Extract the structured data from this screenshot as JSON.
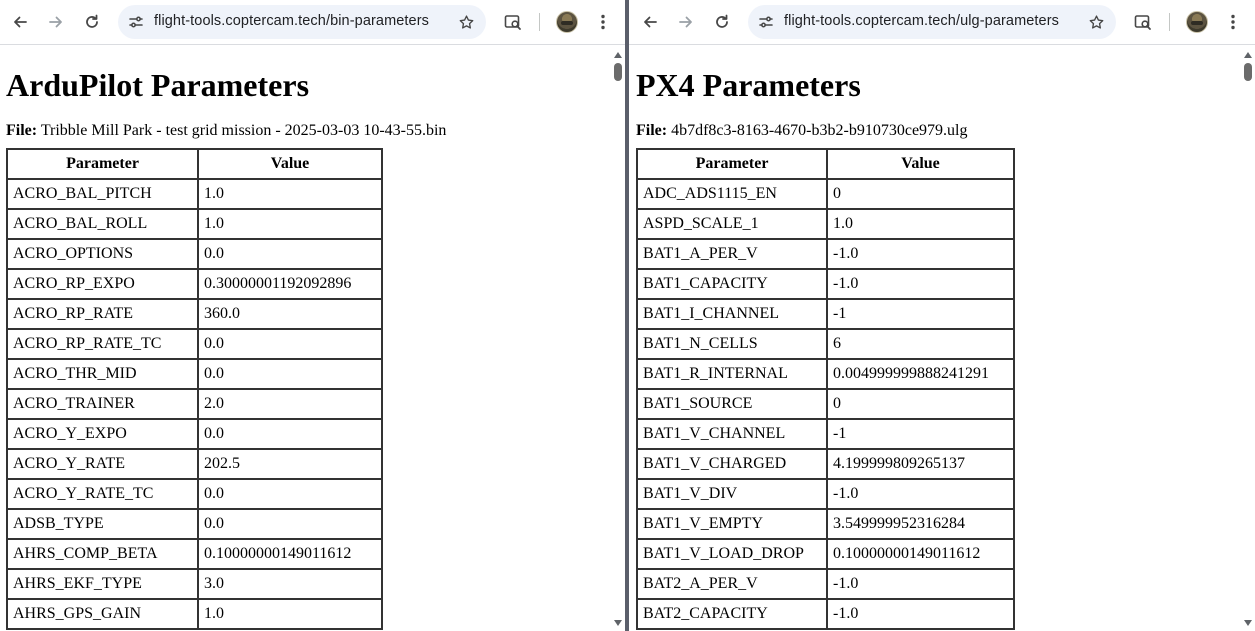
{
  "icons": {
    "back": "arrow-left-icon",
    "forward": "arrow-right-icon",
    "reload": "reload-icon",
    "site_info": "tune-icon",
    "bookmark": "star-icon",
    "page_search": "search-page-icon",
    "profile": "avatar",
    "menu": "kebab-menu-icon"
  },
  "colors": {
    "divider": "#5b5f6b",
    "omnibox_bg": "#eff3fa",
    "table_border": "#333333"
  },
  "left": {
    "url": "flight-tools.coptercam.tech/bin-parameters",
    "title": "ArduPilot Parameters",
    "file_label": "File:",
    "file_name": "Tribble Mill Park - test grid mission - 2025-03-03 10-43-55.bin",
    "headers": {
      "param": "Parameter",
      "value": "Value"
    },
    "rows": [
      {
        "param": "ACRO_BAL_PITCH",
        "value": "1.0"
      },
      {
        "param": "ACRO_BAL_ROLL",
        "value": "1.0"
      },
      {
        "param": "ACRO_OPTIONS",
        "value": "0.0"
      },
      {
        "param": "ACRO_RP_EXPO",
        "value": "0.30000001192092896"
      },
      {
        "param": "ACRO_RP_RATE",
        "value": "360.0"
      },
      {
        "param": "ACRO_RP_RATE_TC",
        "value": "0.0"
      },
      {
        "param": "ACRO_THR_MID",
        "value": "0.0"
      },
      {
        "param": "ACRO_TRAINER",
        "value": "2.0"
      },
      {
        "param": "ACRO_Y_EXPO",
        "value": "0.0"
      },
      {
        "param": "ACRO_Y_RATE",
        "value": "202.5"
      },
      {
        "param": "ACRO_Y_RATE_TC",
        "value": "0.0"
      },
      {
        "param": "ADSB_TYPE",
        "value": "0.0"
      },
      {
        "param": "AHRS_COMP_BETA",
        "value": "0.10000000149011612"
      },
      {
        "param": "AHRS_EKF_TYPE",
        "value": "3.0"
      },
      {
        "param": "AHRS_GPS_GAIN",
        "value": "1.0"
      }
    ]
  },
  "right": {
    "url": "flight-tools.coptercam.tech/ulg-parameters",
    "title": "PX4 Parameters",
    "file_label": "File:",
    "file_name": "4b7df8c3-8163-4670-b3b2-b910730ce979.ulg",
    "headers": {
      "param": "Parameter",
      "value": "Value"
    },
    "rows": [
      {
        "param": "ADC_ADS1115_EN",
        "value": "0"
      },
      {
        "param": "ASPD_SCALE_1",
        "value": "1.0"
      },
      {
        "param": "BAT1_A_PER_V",
        "value": "-1.0"
      },
      {
        "param": "BAT1_CAPACITY",
        "value": "-1.0"
      },
      {
        "param": "BAT1_I_CHANNEL",
        "value": "-1"
      },
      {
        "param": "BAT1_N_CELLS",
        "value": "6"
      },
      {
        "param": "BAT1_R_INTERNAL",
        "value": "0.004999999888241291"
      },
      {
        "param": "BAT1_SOURCE",
        "value": "0"
      },
      {
        "param": "BAT1_V_CHANNEL",
        "value": "-1"
      },
      {
        "param": "BAT1_V_CHARGED",
        "value": "4.199999809265137"
      },
      {
        "param": "BAT1_V_DIV",
        "value": "-1.0"
      },
      {
        "param": "BAT1_V_EMPTY",
        "value": "3.549999952316284"
      },
      {
        "param": "BAT1_V_LOAD_DROP",
        "value": "0.10000000149011612"
      },
      {
        "param": "BAT2_A_PER_V",
        "value": "-1.0"
      },
      {
        "param": "BAT2_CAPACITY",
        "value": "-1.0"
      }
    ]
  }
}
